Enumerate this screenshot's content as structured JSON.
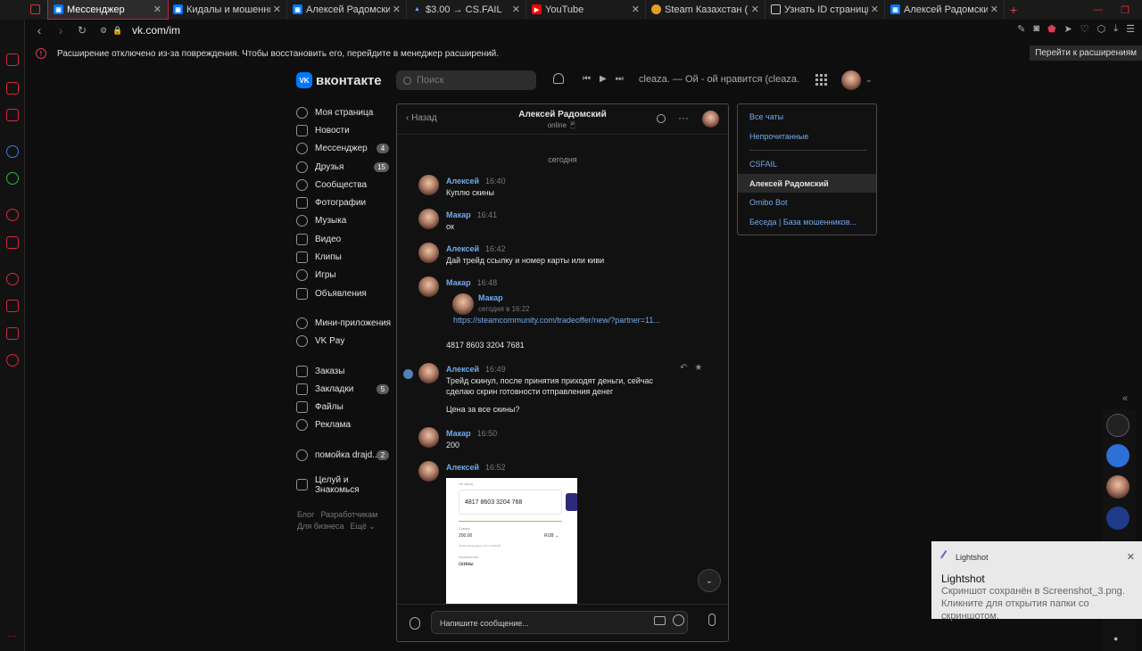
{
  "tabs": [
    {
      "label": "",
      "icon": "mail-icon"
    },
    {
      "label": "Мессенджер",
      "icon": "vk-icon",
      "active": true
    },
    {
      "label": "Кидалы и мошенники в vk",
      "icon": "vk-icon"
    },
    {
      "label": "Алексей Радомский",
      "icon": "vk-icon"
    },
    {
      "label": "$3.00 → CS.FAIL",
      "icon": "csfail-icon"
    },
    {
      "label": "YouTube",
      "icon": "youtube-icon"
    },
    {
      "label": "Steam Казахстан (Payform",
      "icon": "steam-icon"
    },
    {
      "label": "Узнать ID страницы или гр",
      "icon": "page-icon"
    },
    {
      "label": "Алексей Радомский",
      "icon": "vk-icon"
    }
  ],
  "browser": {
    "url": "vk.com/im"
  },
  "infobar": {
    "message": "Расширение отключено из-за повреждения. Чтобы восстановить его, перейдите в менеджер расширений.",
    "button": "Перейти к расширениям"
  },
  "header": {
    "logo": "вконтакте",
    "search_placeholder": "Поиск",
    "track": "cleaza. — Ой - ой нравится (cleaza. …"
  },
  "leftnav": [
    {
      "label": "Моя страница",
      "badge": ""
    },
    {
      "label": "Новости",
      "badge": ""
    },
    {
      "label": "Мессенджер",
      "badge": "4"
    },
    {
      "label": "Друзья",
      "badge": "15"
    },
    {
      "label": "Сообщества",
      "badge": ""
    },
    {
      "label": "Фотографии",
      "badge": ""
    },
    {
      "label": "Музыка",
      "badge": ""
    },
    {
      "label": "Видео",
      "badge": ""
    },
    {
      "label": "Клипы",
      "badge": ""
    },
    {
      "label": "Игры",
      "badge": ""
    },
    {
      "label": "Объявления",
      "badge": ""
    },
    {
      "label": "Мини-приложения",
      "badge": ""
    },
    {
      "label": "VK Pay",
      "badge": ""
    },
    {
      "label": "Заказы",
      "badge": ""
    },
    {
      "label": "Закладки",
      "badge": "5"
    },
    {
      "label": "Файлы",
      "badge": ""
    },
    {
      "label": "Реклама",
      "badge": ""
    },
    {
      "label": "помойка drajd...",
      "badge": "2"
    },
    {
      "label": "Целуй и Знакомься",
      "badge": ""
    }
  ],
  "footer": {
    "blog": "Блог",
    "dev": "Разработчикам",
    "business": "Для бизнеса",
    "more": "Ещё ⌄"
  },
  "chat": {
    "back": "Назад",
    "title": "Алексей Радомский",
    "status": "online 📱",
    "date": "сегодня",
    "messages": [
      {
        "author": "Алексей",
        "time": "16:40",
        "text": "Куплю скины"
      },
      {
        "author": "Макар",
        "time": "16:41",
        "text": "ок"
      },
      {
        "author": "Алексей",
        "time": "16:42",
        "text": "Дай трейд ссылку и номер карты или киви"
      },
      {
        "author": "Макар",
        "time": "16:48",
        "text": ""
      },
      {
        "author": "Алексей",
        "time": "16:49",
        "text": "Трейд скинул, после принятия приходят деньги, сейчас сделаю скрин готовности отправления денег"
      },
      {
        "author": "",
        "time": "",
        "text": "Цена за все скины?"
      },
      {
        "author": "Макар",
        "time": "16:50",
        "text": "200"
      },
      {
        "author": "Алексей",
        "time": "16:52",
        "text": ""
      }
    ],
    "forward": {
      "author": "Макар",
      "date": "сегодня в 16:22"
    },
    "link": "https://steamcommunity.com/tradeoffer/new/?partner=11...",
    "card_number": "4817 8603 3204 7681",
    "screenshot": {
      "label_card": "На карту",
      "card": "4817 8603 3204 768",
      "label_sum": "Сумма",
      "sum": "200.00",
      "currency": "RUB ⌄",
      "rate": "70.00 сом на карту 1 ₽ = 0.3744 ₽",
      "label_purpose": "Назначение",
      "purpose": "скины"
    },
    "composer_placeholder": "Напишите сообщение..."
  },
  "chatlist": [
    {
      "label": "Все чаты"
    },
    {
      "label": "Непрочитанные"
    },
    {
      "label": "CSFAIL"
    },
    {
      "label": "Алексей Радомский",
      "selected": true
    },
    {
      "label": "Omibo Bot"
    },
    {
      "label": "Беседа | База мошенников..."
    }
  ],
  "lightshot": {
    "app": "Lightshot",
    "title": "Lightshot",
    "body": "Скриншот сохранён в Screenshot_3.png. Кликните для открытия папки со скриншотом."
  },
  "colors": {
    "accent": "#71aaeb",
    "opera_red": "#d8283d",
    "vk_blue": "#0077ff"
  }
}
